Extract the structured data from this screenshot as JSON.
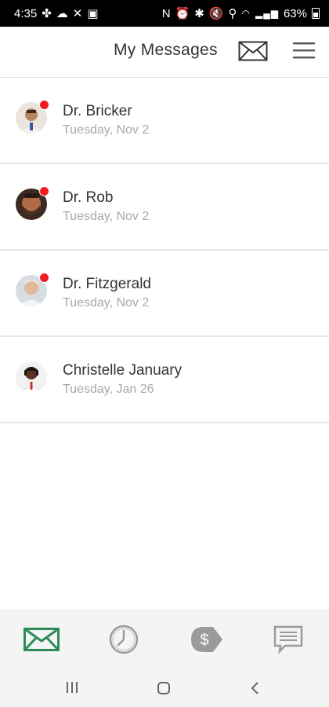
{
  "status_bar": {
    "time": "4:35",
    "left_icons": [
      "slack-icon",
      "cloud-icon",
      "x-icon",
      "image-icon"
    ],
    "right_icons": [
      "nfc-icon",
      "alarm-icon",
      "bluetooth-icon",
      "mute-icon",
      "location-icon",
      "wifi-icon",
      "signal-icon"
    ],
    "battery": "63%"
  },
  "header": {
    "title": "My Messages"
  },
  "messages": [
    {
      "name": "Dr. Bricker",
      "date": "Tuesday, Nov 2",
      "unread": true
    },
    {
      "name": "Dr. Rob",
      "date": "Tuesday, Nov 2",
      "unread": true
    },
    {
      "name": "Dr. Fitzgerald",
      "date": "Tuesday, Nov 2",
      "unread": true
    },
    {
      "name": "Christelle January",
      "date": "Tuesday, Jan 26",
      "unread": false
    }
  ],
  "bottom_nav": {
    "items": [
      "messages-icon",
      "history-icon",
      "billing-icon",
      "chat-icon"
    ],
    "active": "messages-icon",
    "active_color": "#2e8b57",
    "inactive_color": "#9a9a9a"
  },
  "colors": {
    "unread_dot": "#ef1d22",
    "divider": "#e6e6e6"
  }
}
